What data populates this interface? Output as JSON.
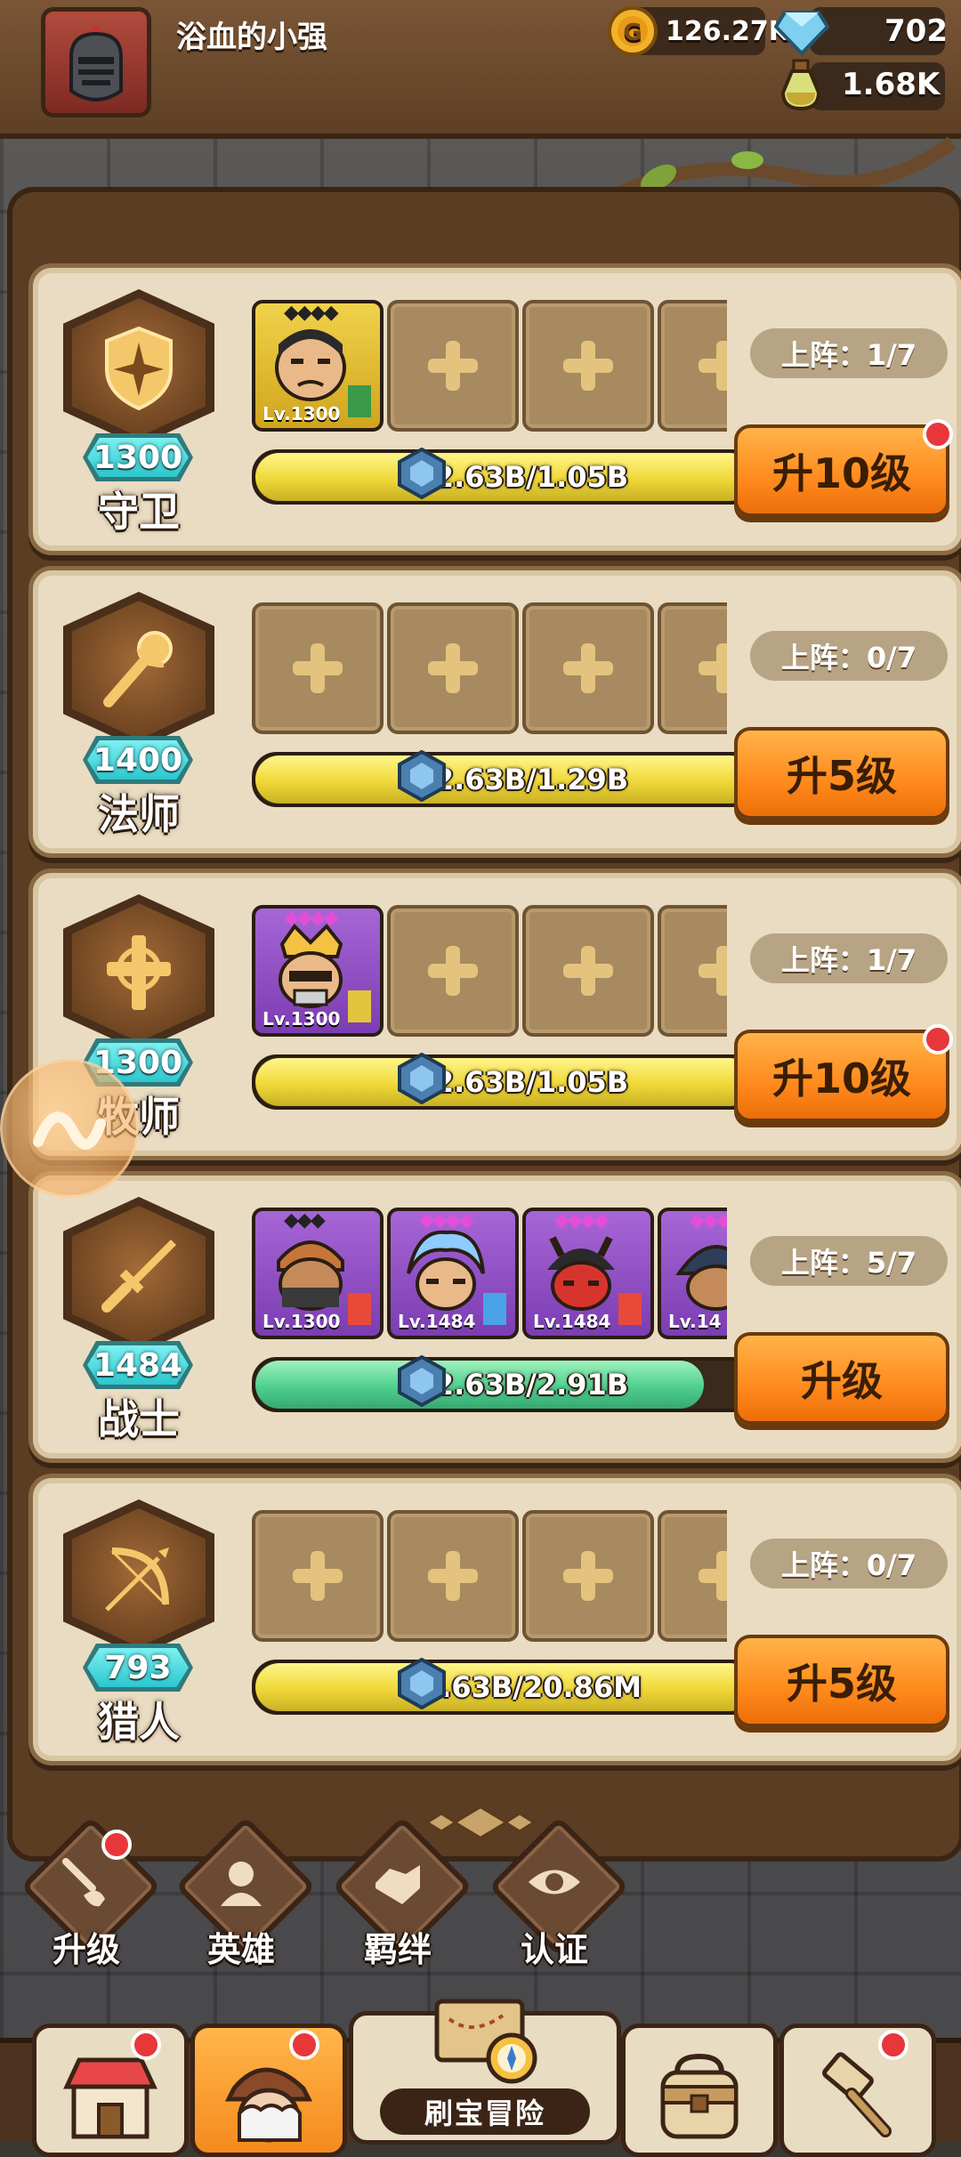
{
  "player": {
    "name": "浴血的小强"
  },
  "currencies": {
    "gold": "126.27K",
    "diamond": "702",
    "potion": "1.68K"
  },
  "classes": [
    {
      "id": "guard",
      "name": "守卫",
      "level": "1300",
      "deploy": "上阵：1/7",
      "progress_text": "2.63B/1.05B",
      "progress": 1.0,
      "bar_color": "yellow",
      "button": "升10级",
      "has_dot": true,
      "heroes": [
        {
          "lv": "Lv.1300",
          "stars": "◆◆◆◆"
        }
      ]
    },
    {
      "id": "mage",
      "name": "法师",
      "level": "1400",
      "deploy": "上阵：0/7",
      "progress_text": "2.63B/1.29B",
      "progress": 1.0,
      "bar_color": "yellow",
      "button": "升5级",
      "has_dot": false,
      "heroes": []
    },
    {
      "id": "priest",
      "name": "牧师",
      "level": "1300",
      "deploy": "上阵：1/7",
      "progress_text": "2.63B/1.05B",
      "progress": 1.0,
      "bar_color": "yellow",
      "button": "升10级",
      "has_dot": true,
      "heroes": [
        {
          "lv": "Lv.1300",
          "stars": "◆◆◆◆"
        }
      ]
    },
    {
      "id": "warrior",
      "name": "战士",
      "level": "1484",
      "deploy": "上阵：5/7",
      "progress_text": "2.63B/2.91B",
      "progress": 0.9,
      "bar_color": "green",
      "button": "升级",
      "has_dot": false,
      "heroes": [
        {
          "lv": "Lv.1300",
          "stars": "◆◆◆"
        },
        {
          "lv": "Lv.1484",
          "stars": "◆◆◆◆"
        },
        {
          "lv": "Lv.1484",
          "stars": "◆◆◆◆"
        },
        {
          "lv": "Lv.14",
          "stars": "◆◆◆"
        }
      ]
    },
    {
      "id": "hunter",
      "name": "猎人",
      "level": "793",
      "deploy": "上阵：0/7",
      "progress_text": "2.63B/20.86M",
      "progress": 1.0,
      "bar_color": "yellow",
      "button": "升5级",
      "has_dot": false,
      "heroes": []
    }
  ],
  "sub_nav": [
    {
      "label": "升级",
      "icon": "sword-shield-icon",
      "has_dot": true
    },
    {
      "label": "英雄",
      "icon": "hero-icon",
      "has_dot": false
    },
    {
      "label": "羁绊",
      "icon": "handshake-icon",
      "has_dot": false
    },
    {
      "label": "认证",
      "icon": "eye-icon",
      "has_dot": false
    }
  ],
  "bottom_nav": {
    "adventure_label": "刷宝冒险",
    "tabs": [
      {
        "name": "shop",
        "icon": "shop-icon",
        "has_dot": true
      },
      {
        "name": "hero",
        "icon": "hero-portrait-icon",
        "has_dot": true,
        "active": true
      },
      {
        "name": "bag",
        "icon": "backpack-icon",
        "has_dot": false
      },
      {
        "name": "forge",
        "icon": "hammer-icon",
        "has_dot": true
      }
    ]
  },
  "colors": {
    "accent_orange": "#ff8a1c",
    "dot_red": "#e8373a",
    "teal": "#2cc7cf"
  }
}
